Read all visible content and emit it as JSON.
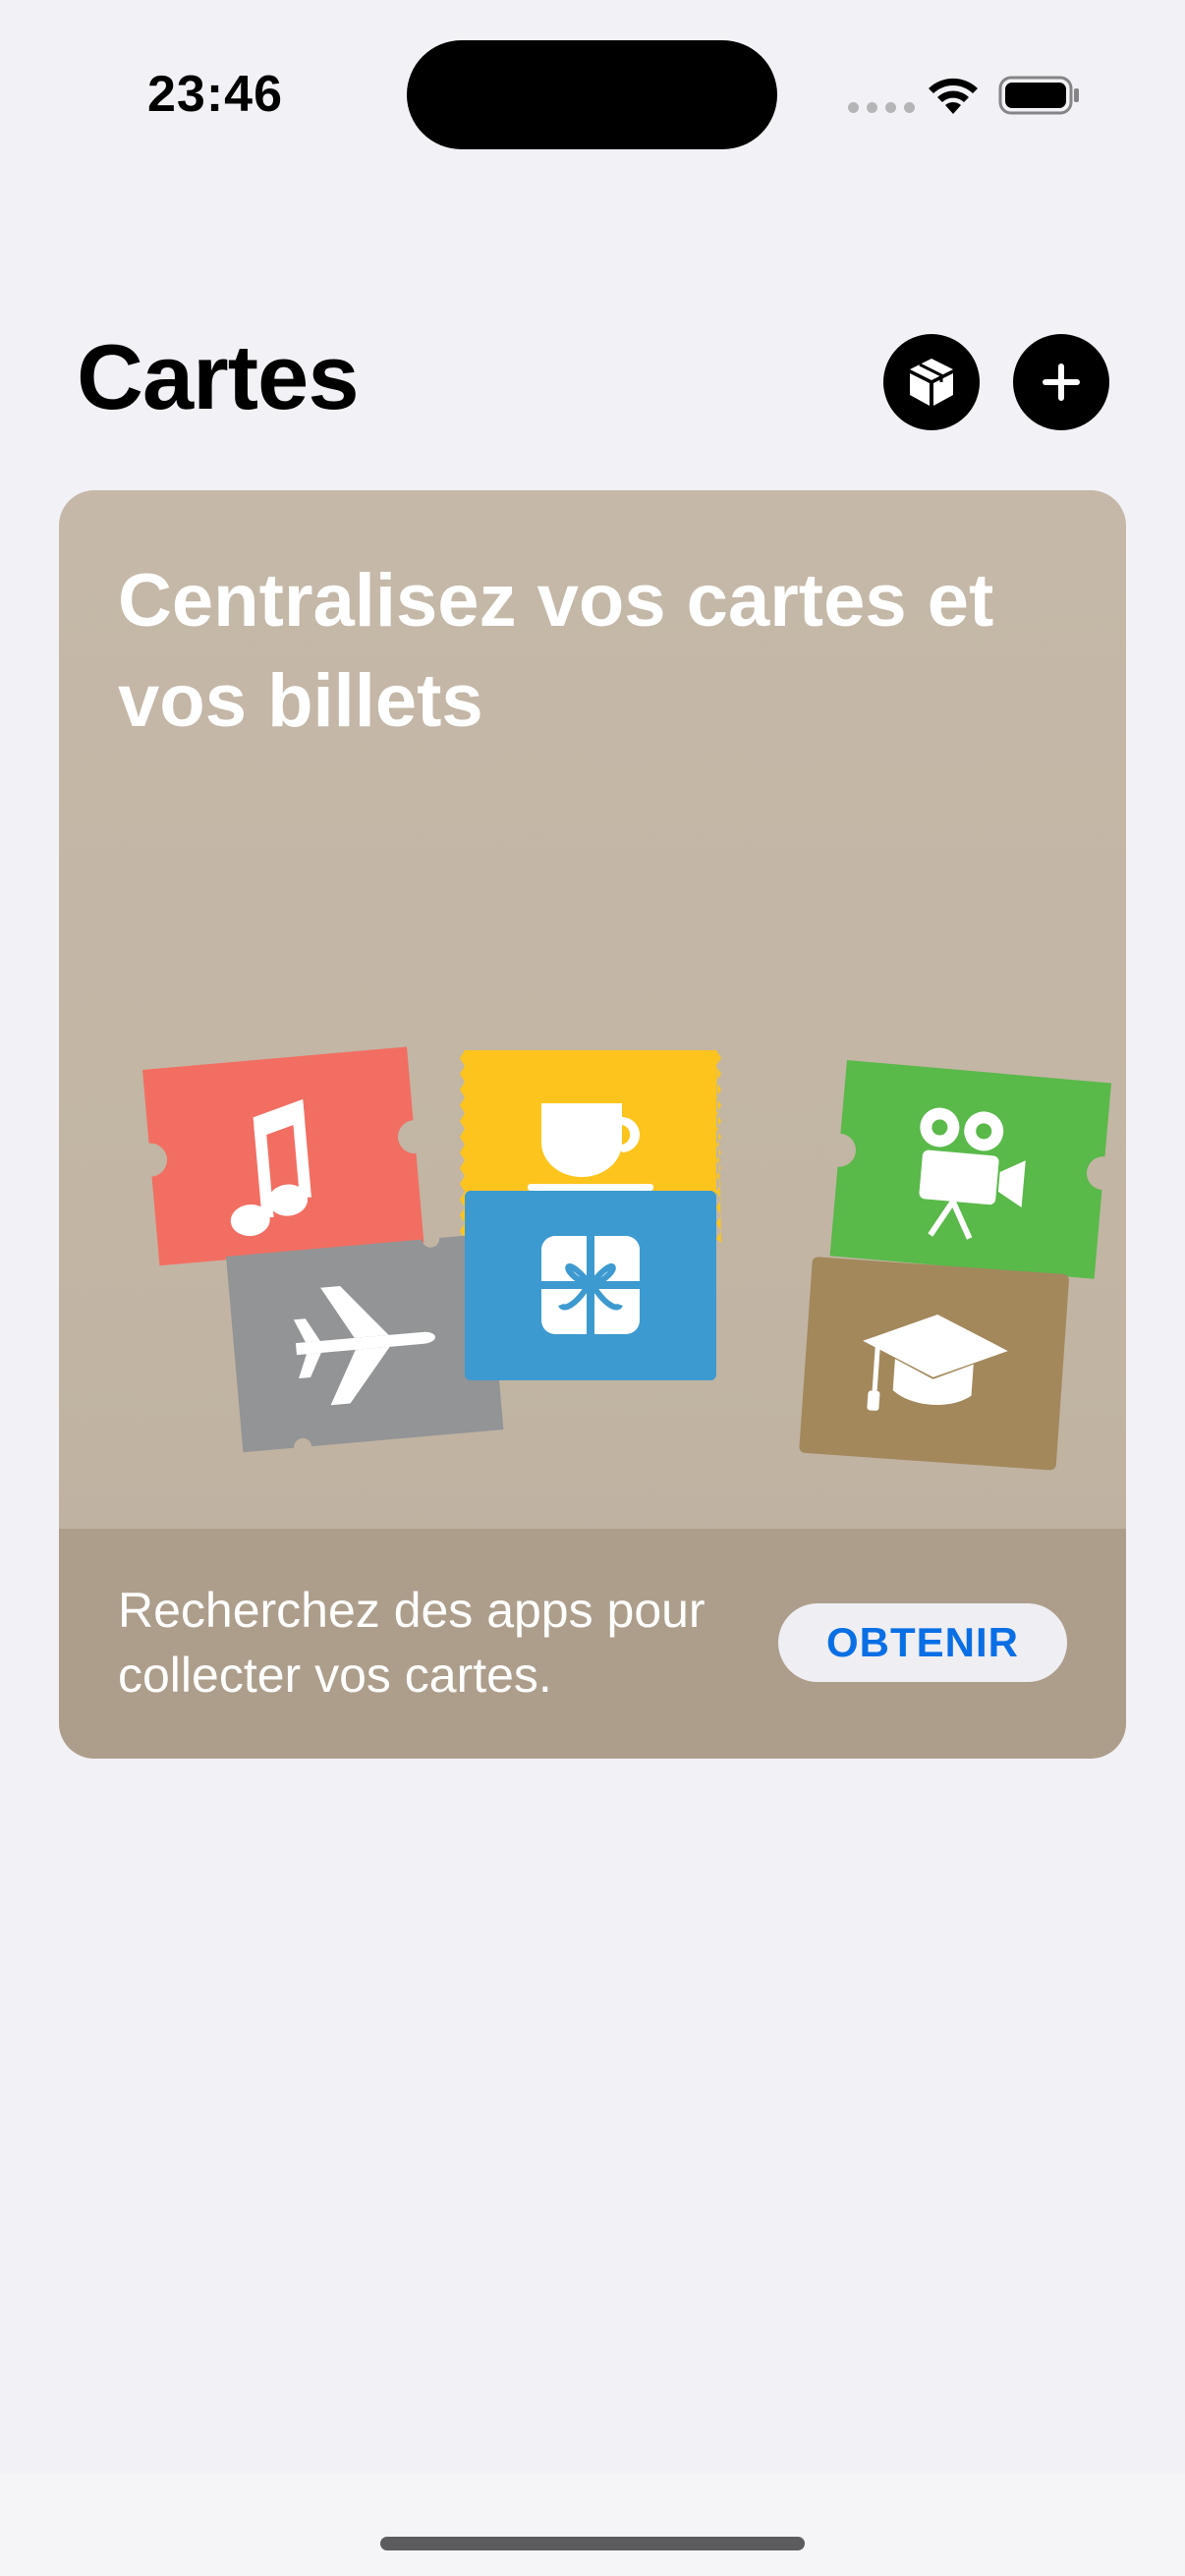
{
  "status_bar": {
    "time": "23:46"
  },
  "header": {
    "title": "Cartes",
    "pass_button_icon": "wallet-pass-icon",
    "add_button_icon": "plus-icon"
  },
  "promo": {
    "title": "Centralisez vos cartes et vos billets",
    "footer_text": "Recherchez des apps pour collecter vos cartes.",
    "get_label": "OBTENIR",
    "tiles": [
      {
        "icon": "music-note-icon",
        "color": "#f26e62"
      },
      {
        "icon": "coffee-cup-icon",
        "color": "#fdc41d"
      },
      {
        "icon": "movie-camera-icon",
        "color": "#59b949"
      },
      {
        "icon": "airplane-icon",
        "color": "#929496"
      },
      {
        "icon": "gift-icon",
        "color": "#3d9ad0"
      },
      {
        "icon": "graduation-cap-icon",
        "color": "#a3885c"
      }
    ]
  },
  "colors": {
    "background": "#f2f1f6",
    "card_bg": "#c5b8a8",
    "card_footer": "#ad9e8c",
    "accent": "#0a6fe5"
  }
}
